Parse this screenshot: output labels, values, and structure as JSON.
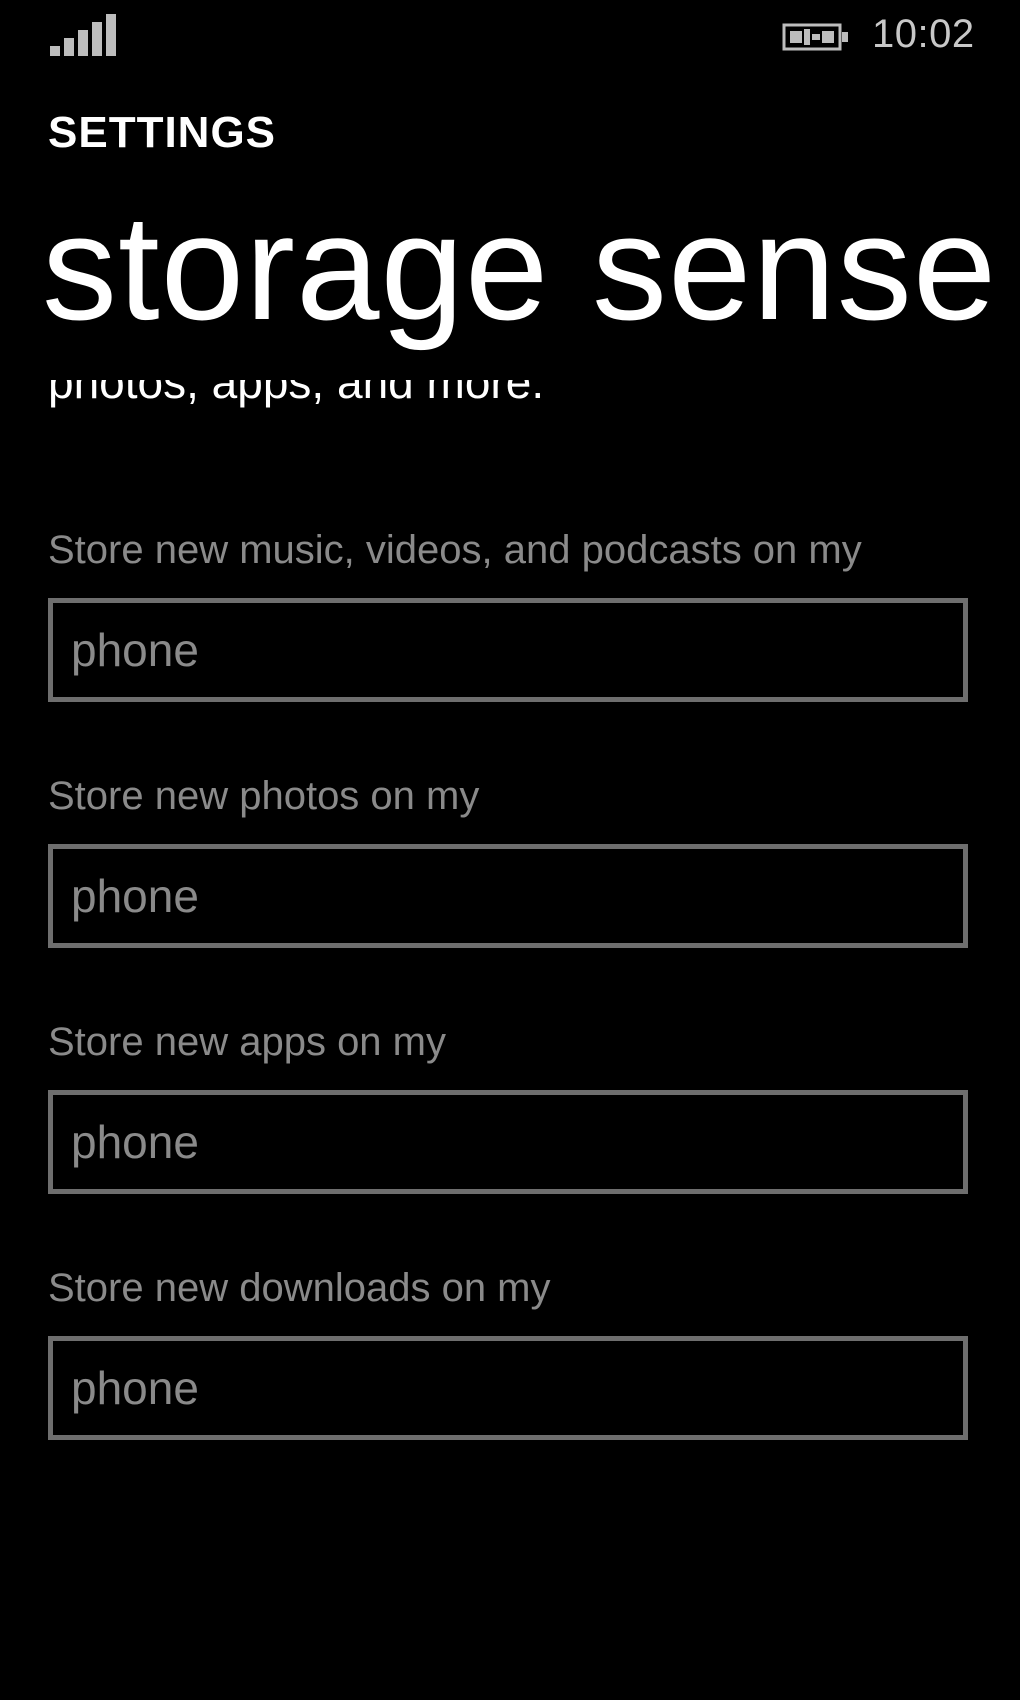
{
  "status_bar": {
    "time": "10:02",
    "signal_icon": "signal-strength-icon",
    "battery_icon": "battery-charging-icon"
  },
  "header": {
    "app_title": "SETTINGS",
    "page_title": "storage sense",
    "description_fragment": "photos, apps, and more."
  },
  "settings": [
    {
      "label": "Store new music, videos, and podcasts on my",
      "value": "phone"
    },
    {
      "label": "Store new photos on my",
      "value": "phone"
    },
    {
      "label": "Store new apps on my",
      "value": "phone"
    },
    {
      "label": "Store new downloads on my",
      "value": "phone"
    }
  ],
  "colors": {
    "background": "#000000",
    "label_gray": "#8a8a8a",
    "box_border": "#6e6e6e"
  }
}
